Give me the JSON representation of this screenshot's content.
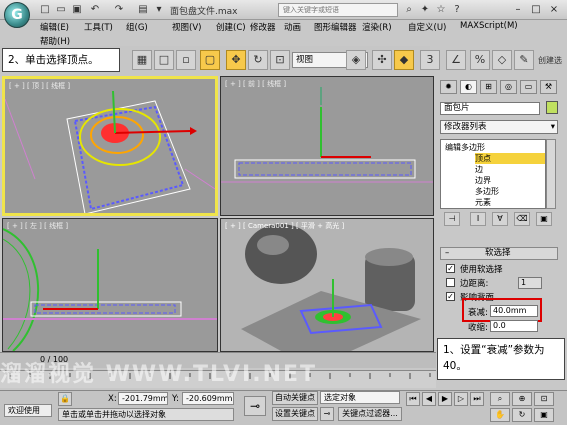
{
  "title_bar": {
    "logo_text": "G",
    "document_title": "面包盘文件.max",
    "search_placeholder": "键入关键字或短语"
  },
  "menu": {
    "items": [
      "编辑(E)",
      "工具(T)",
      "组(G)",
      "视图(V)",
      "创建(C)",
      "修改器",
      "动画",
      "图形编辑器",
      "渲染(R)",
      "自定义(U)",
      "MAXScript(M)"
    ],
    "help": "帮助(H)"
  },
  "toolbar": {
    "view_select": "视图",
    "create_selection_label": "创建选"
  },
  "callouts": {
    "step2": "2、单击选择顶点。",
    "step1": "1、设置“衰减”参数为 40。"
  },
  "viewports": {
    "top": "[ + ] [ 顶 ] [ 线框 ]",
    "front": "[ + ] [ 前 ] [ 线框 ]",
    "left": "[ + ] [ 左 ] [ 线框 ]",
    "camera": "[ + ] [ Camera001 ] [ 平滑 + 高光 ]"
  },
  "command_panel": {
    "object_name": "面包片",
    "modifier_list": "修改器列表",
    "stack": {
      "root": "编辑多边形",
      "items": [
        "顶点",
        "边",
        "边界",
        "多边形",
        "元素"
      ],
      "selected": "顶点"
    },
    "soft_selection": {
      "header": "软选择",
      "use_soft_selection": "使用软选择",
      "edge_distance": "边距离:",
      "edge_distance_value": "1",
      "affect_backfacing": "影响背面",
      "falloff_label": "衰减:",
      "falloff_value": "40.0mm",
      "pinch_label": "收缩:",
      "pinch_value": "0.0"
    }
  },
  "timeline": {
    "frame_counter": "0 / 100"
  },
  "status": {
    "welcome": "欢迎使用",
    "prompt": "单击或单击并拖动以选择对象",
    "x_label": "X:",
    "x_value": "-201.79mm",
    "y_label": "Y:",
    "y_value": "-20.609mm",
    "auto_key": "自动关键点",
    "set_key": "设置关键点",
    "selected_object": "选定对象",
    "key_filters": "关键点过滤器..."
  },
  "watermark": "溜溜视觉 WWW.TLVI.NET"
}
